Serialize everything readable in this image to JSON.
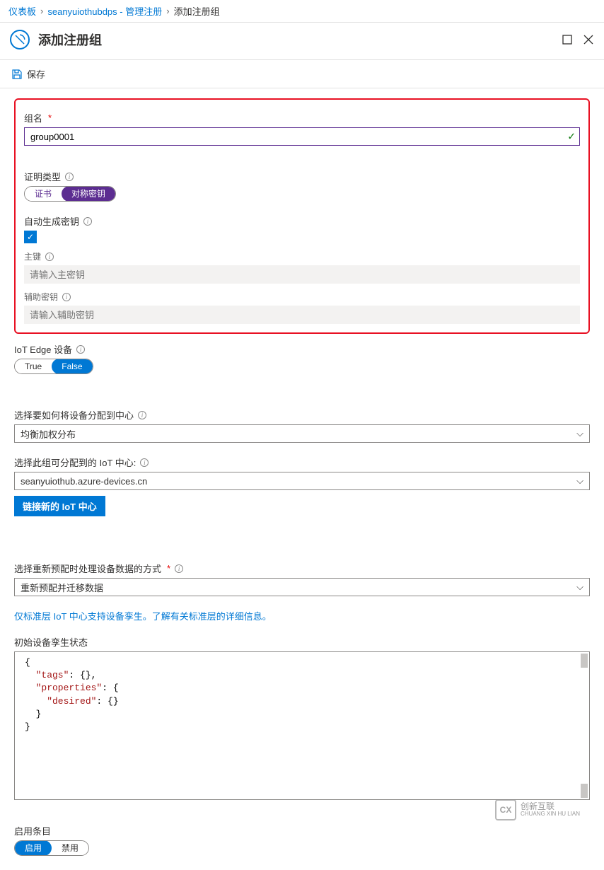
{
  "breadcrumb": {
    "dashboard": "仪表板",
    "service": "seanyuiothubdps - 管理注册",
    "current": "添加注册组"
  },
  "header": {
    "title": "添加注册组"
  },
  "toolbar": {
    "save_label": "保存"
  },
  "fields": {
    "group_name": {
      "label": "组名",
      "value": "group0001"
    },
    "attestation_type": {
      "label": "证明类型",
      "opt_cert": "证书",
      "opt_symkey": "对称密钥"
    },
    "auto_gen": {
      "label": "自动生成密钥"
    },
    "primary_key": {
      "label": "主键",
      "placeholder": "请输入主密钥"
    },
    "secondary_key": {
      "label": "辅助密钥",
      "placeholder": "请输入辅助密钥"
    },
    "iot_edge": {
      "label": "IoT Edge 设备",
      "opt_true": "True",
      "opt_false": "False"
    },
    "allocation": {
      "label": "选择要如何将设备分配到中心",
      "value": "均衡加权分布"
    },
    "assignable_hub": {
      "label": "选择此组可分配到的 IoT 中心:",
      "value": "seanyuiothub.azure-devices.cn"
    },
    "link_new_hub_btn": "链接新的 IoT 中心",
    "reprovision": {
      "label": "选择重新预配时处理设备数据的方式",
      "value": "重新预配并迁移数据"
    },
    "info_text": "仅标准层 IoT 中心支持设备孪生。了解有关标准层的详细信息。",
    "initial_twin": {
      "label": "初始设备孪生状态"
    },
    "enable_entry": {
      "label": "启用条目",
      "opt_enable": "启用",
      "opt_disable": "禁用"
    }
  },
  "code": {
    "l1": "{",
    "l2a": "  \"tags\"",
    "l2b": ": {}",
    "l2c": ",",
    "l3a": "  \"properties\"",
    "l3b": ": {",
    "l4a": "    \"desired\"",
    "l4b": ": {}",
    "l5": "  }",
    "l6": "}"
  },
  "watermark": {
    "logo": "CX",
    "line1": "创新互联",
    "line2": "CHUANG XIN HU LIAN"
  }
}
